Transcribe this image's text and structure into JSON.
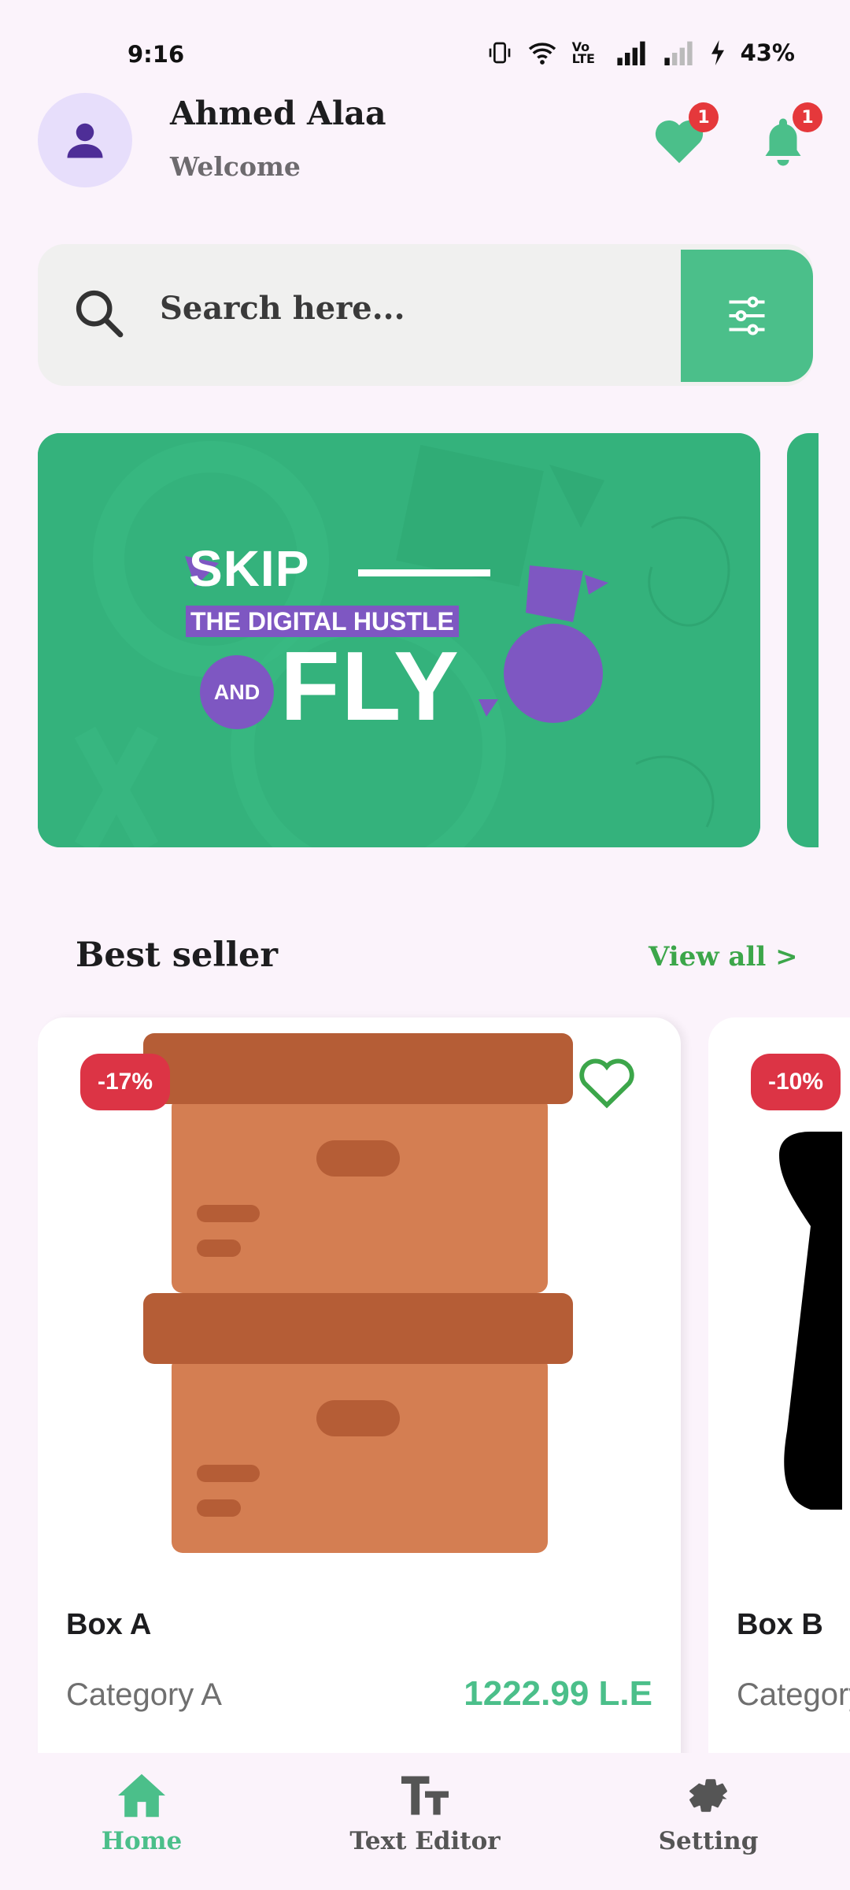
{
  "status_bar": {
    "time": "9:16",
    "volte": "Vo LTE",
    "battery": "43%"
  },
  "header": {
    "user_name": "Ahmed Alaa",
    "greeting": "Welcome",
    "favorites_count": "1",
    "notifications_count": "1",
    "icons": {
      "avatar": "person-icon",
      "favorites": "heart-icon",
      "notifications": "bell-icon"
    }
  },
  "search": {
    "placeholder": "Search here...",
    "icons": {
      "search": "search-icon",
      "filter": "sliders-icon"
    }
  },
  "banner": {
    "line1": "SKIP",
    "line2": "THE DIGITAL HUSTLE",
    "line3_small": "AND",
    "line3_big": "FLY",
    "colors": {
      "background": "#34B27C",
      "accent": "#7E57C2"
    }
  },
  "best_seller": {
    "title": "Best seller",
    "view_all": "View all >",
    "products": [
      {
        "discount": "-17%",
        "name": "Box A",
        "category": "Category A",
        "price": "1222.99 L.E",
        "favorite": false
      },
      {
        "discount": "-10%",
        "name": "Box B",
        "category": "Category B"
      }
    ]
  },
  "bottom_nav": {
    "items": [
      {
        "label": "Home",
        "icon": "home-icon",
        "active": true
      },
      {
        "label": "Text Editor",
        "icon": "text-size-icon",
        "active": false
      },
      {
        "label": "Setting",
        "icon": "gear-icon",
        "active": false
      }
    ],
    "active_color": "#4BBF8A",
    "inactive_color": "#555555"
  }
}
